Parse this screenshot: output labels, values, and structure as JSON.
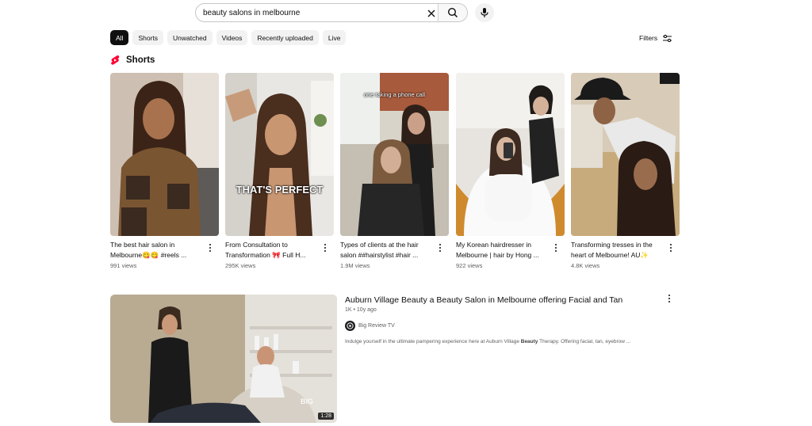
{
  "search": {
    "query": "beauty salons in melbourne"
  },
  "chips": [
    "All",
    "Shorts",
    "Unwatched",
    "Videos",
    "Recently uploaded",
    "Live"
  ],
  "filters_label": "Filters",
  "shorts_section": {
    "title": "Shorts",
    "items": [
      {
        "title": "The best hair salon in Melbourne😋😋 #reels ...",
        "views": "991 views",
        "overlay": ""
      },
      {
        "title": "From Consultation to Transformation 🎀 Full H...",
        "views": "295K views",
        "overlay": "THAT'S PERFECT"
      },
      {
        "title": "Types of clients at the hair salon ##hairstylist #hair ...",
        "views": "1.9M views",
        "overlay": "one taking a phone call"
      },
      {
        "title": "My Korean hairdresser in Melbourne | hair by Hong ...",
        "views": "922 views",
        "overlay": ""
      },
      {
        "title": "Transforming tresses in the heart of Melbourne! AU✨",
        "views": "4.8K views",
        "overlay": ""
      }
    ]
  },
  "video": {
    "title": "Auburn Village Beauty a Beauty Salon in Melbourne offering Facial and Tan",
    "meta": "1K • 10y ago",
    "channel": "Big Review TV",
    "duration": "1:28",
    "watermark": "BIG",
    "desc_prefix": "Indulge yourself in the ultimate pampering experience here at Auburn Village ",
    "desc_bold": "Beauty",
    "desc_suffix": " Therapy. Offering facial, tan, eyebrow ..."
  }
}
